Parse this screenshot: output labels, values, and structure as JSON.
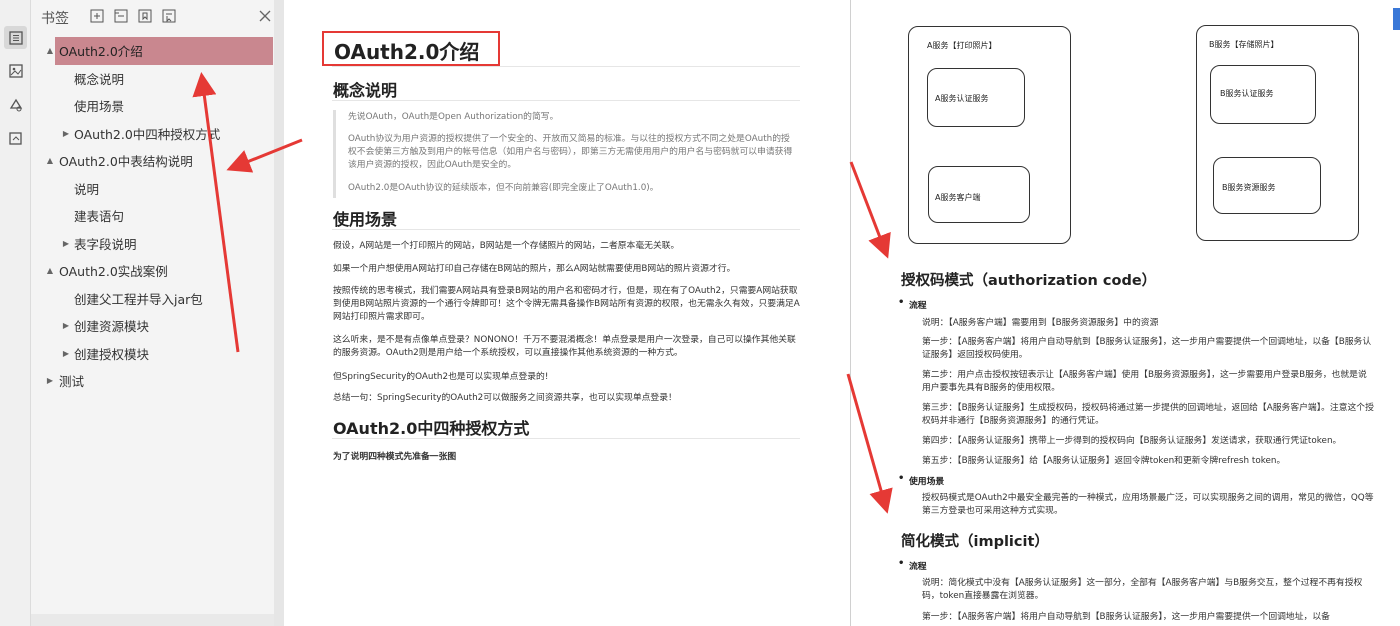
{
  "panel": {
    "title": "书签",
    "tools": [
      "expand-all-icon",
      "collapse-all-icon",
      "add-bookmark-icon",
      "bookmark-options-icon"
    ]
  },
  "tree": [
    {
      "label": "OAuth2.0介绍",
      "level": 0,
      "toggle": "▲",
      "selected": true
    },
    {
      "label": "概念说明",
      "level": 1,
      "toggle": ""
    },
    {
      "label": "使用场景",
      "level": 1,
      "toggle": ""
    },
    {
      "label": "OAuth2.0中四种授权方式",
      "level": 1,
      "toggle": "▶"
    },
    {
      "label": "OAuth2.0中表结构说明",
      "level": 0,
      "toggle": "▲"
    },
    {
      "label": "说明",
      "level": 1,
      "toggle": ""
    },
    {
      "label": "建表语句",
      "level": 1,
      "toggle": ""
    },
    {
      "label": "表字段说明",
      "level": 1,
      "toggle": "▶"
    },
    {
      "label": "OAuth2.0实战案例",
      "level": 0,
      "toggle": "▲"
    },
    {
      "label": "创建父工程并导入jar包",
      "level": 1,
      "toggle": ""
    },
    {
      "label": "创建资源模块",
      "level": 1,
      "toggle": "▶"
    },
    {
      "label": "创建授权模块",
      "level": 1,
      "toggle": "▶"
    },
    {
      "label": "测试",
      "level": 0,
      "toggle": "▶"
    }
  ],
  "page1": {
    "title": "OAuth2.0介绍",
    "h_concept": "概念说明",
    "q1": "先说OAuth，OAuth是Open Authorization的简写。",
    "q2": "OAuth协议为用户资源的授权提供了一个安全的、开放而又简易的标准。与以往的授权方式不同之处是OAuth的授权不会使第三方触及到用户的帐号信息（如用户名与密码），即第三方无需使用用户的用户名与密码就可以申请获得该用户资源的授权，因此OAuth是安全的。",
    "q3": "OAuth2.0是OAuth协议的延续版本，但不向前兼容(即完全废止了OAuth1.0)。",
    "h_scene": "使用场景",
    "p1": "假设，A网站是一个打印照片的网站，B网站是一个存储照片的网站，二者原本毫无关联。",
    "p2": "如果一个用户想使用A网站打印自己存储在B网站的照片，那么A网站就需要使用B网站的照片资源才行。",
    "p3": "按照传统的思考模式，我们需要A网站具有登录B网站的用户名和密码才行，但是，现在有了OAuth2，只需要A网站获取到使用B网站照片资源的一个通行令牌即可！这个令牌无需具备操作B网站所有资源的权限，也无需永久有效，只要满足A网站打印照片需求即可。",
    "p4": "这么听来，是不是有点像单点登录？NONONO！千万不要混淆概念！单点登录是用户一次登录，自己可以操作其他关联的服务资源。OAuth2则是用户给一个系统授权，可以直接操作其他系统资源的一种方式。",
    "p5": "但SpringSecurity的OAuth2也是可以实现单点登录的!",
    "p6": "总结一句：SpringSecurity的OAuth2可以做服务之间资源共享，也可以实现单点登录！",
    "h_four": "OAuth2.0中四种授权方式",
    "p7": "为了说明四种模式先准备一张图"
  },
  "page2": {
    "diagram": {
      "a_service": "A服务【打印照片】",
      "a_auth": "A服务认证服务",
      "a_client": "A服务客户端",
      "b_service": "B服务【存储照片】",
      "b_auth": "B服务认证服务",
      "b_resource": "B服务资源服务"
    },
    "h_code": "授权码模式（authorization code）",
    "b_flow": "流程",
    "c1": "说明：【A服务客户端】需要用到【B服务资源服务】中的资源",
    "c2": "第一步：【A服务客户端】将用户自动导航到【B服务认证服务】，这一步用户需要提供一个回调地址，以备【B服务认证服务】返回授权码使用。",
    "c3": "第二步：用户点击授权按钮表示让【A服务客户端】使用【B服务资源服务】，这一步需要用户登录B服务，也就是说用户要事先具有B服务的使用权限。",
    "c4": "第三步：【B服务认证服务】生成授权码，授权码将通过第一步提供的回调地址，返回给【A服务客户端】。注意这个授权码并非通行【B服务资源服务】的通行凭证。",
    "c5": "第四步：【A服务认证服务】携带上一步得到的授权码向【B服务认证服务】发送请求，获取通行凭证token。",
    "c6": "第五步：【B服务认证服务】给【A服务认证服务】返回令牌token和更新令牌refresh token。",
    "b_scene": "使用场景",
    "c7": "授权码模式是OAuth2中最安全最完善的一种模式，应用场景最广泛，可以实现服务之间的调用，常见的微信，QQ等第三方登录也可采用这种方式实现。",
    "h_implicit": "简化模式（implicit）",
    "b_flow2": "流程",
    "i1": "说明：简化模式中没有【A服务认证服务】这一部分，全部有【A服务客户端】与B服务交互，整个过程不再有授权码，token直接暴露在浏览器。",
    "i2": "第一步：【A服务客户端】将用户自动导航到【B服务认证服务】，这一步用户需要提供一个回调地址，以备"
  },
  "colors": {
    "selected_bg": "#c9878f",
    "arrow": "#e53935",
    "title_border": "#e53935"
  }
}
